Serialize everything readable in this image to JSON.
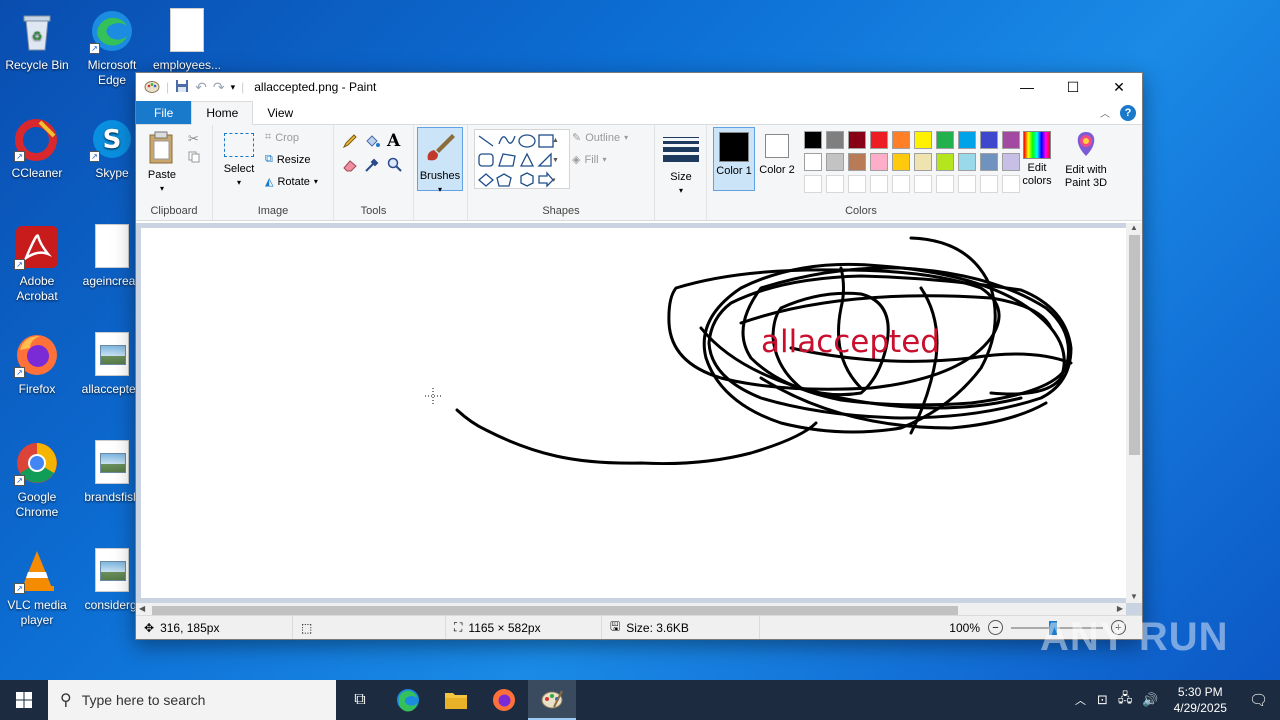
{
  "desktop": {
    "icons": [
      {
        "label": "Recycle Bin"
      },
      {
        "label": "Microsoft Edge"
      },
      {
        "label": "employees..."
      },
      {
        "label": "CCleaner"
      },
      {
        "label": "Skype"
      },
      {
        "label": "Adobe Acrobat"
      },
      {
        "label": "ageincreas"
      },
      {
        "label": "Firefox"
      },
      {
        "label": "allaccepted"
      },
      {
        "label": "Google Chrome"
      },
      {
        "label": "brandsfish"
      },
      {
        "label": "VLC media player"
      },
      {
        "label": "considergi"
      }
    ]
  },
  "window": {
    "title": "allaccepted.png - Paint",
    "menu": {
      "file": "File",
      "home": "Home",
      "view": "View"
    },
    "ribbon": {
      "clipboard": {
        "paste": "Paste",
        "label": "Clipboard"
      },
      "image": {
        "select": "Select",
        "crop": "Crop",
        "resize": "Resize",
        "rotate": "Rotate",
        "label": "Image"
      },
      "tools": {
        "label": "Tools"
      },
      "brushes": {
        "label": "Brushes"
      },
      "shapes": {
        "outline": "Outline",
        "fill": "Fill",
        "label": "Shapes"
      },
      "size": {
        "label": "Size"
      },
      "colors": {
        "color1": "Color 1",
        "color2": "Color 2",
        "label": "Colors",
        "edit_colors": "Edit colors",
        "edit_3d": "Edit with Paint 3D",
        "color1_value": "#000000",
        "color2_value": "#ffffff",
        "palette_row1": [
          "#000000",
          "#7f7f7f",
          "#880015",
          "#ed1c24",
          "#ff7f27",
          "#fff200",
          "#22b14c",
          "#00a2e8",
          "#3f48cc",
          "#a349a4"
        ],
        "palette_row2": [
          "#ffffff",
          "#c3c3c3",
          "#b97a57",
          "#ffaec9",
          "#ffc90e",
          "#efe4b0",
          "#b5e61d",
          "#99d9ea",
          "#7092be",
          "#c8bfe7"
        ]
      }
    },
    "canvas": {
      "text": "allaccepted",
      "text_color": "#c8102e"
    },
    "status": {
      "cursor": "316, 185px",
      "dimensions": "1165 × 582px",
      "size": "Size: 3.6KB",
      "zoom": "100%"
    }
  },
  "taskbar": {
    "search_placeholder": "Type here to search",
    "time": "5:30 PM",
    "date": "4/29/2025"
  },
  "watermark": "ANY RUN"
}
